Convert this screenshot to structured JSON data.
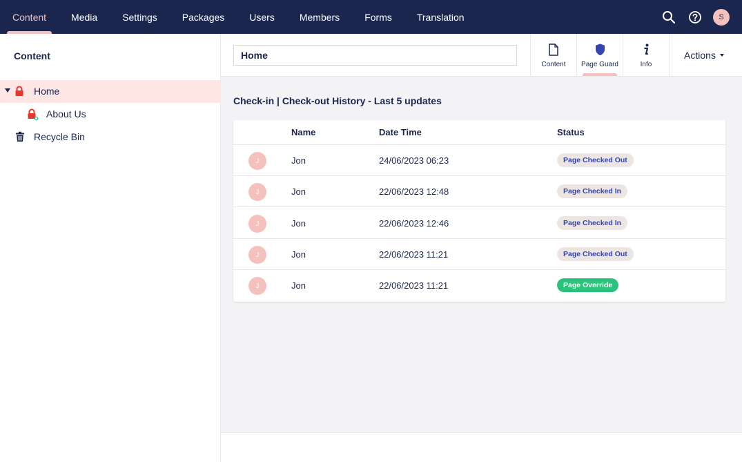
{
  "topnav": {
    "items": [
      {
        "label": "Content",
        "active": true
      },
      {
        "label": "Media"
      },
      {
        "label": "Settings"
      },
      {
        "label": "Packages"
      },
      {
        "label": "Users"
      },
      {
        "label": "Members"
      },
      {
        "label": "Forms"
      },
      {
        "label": "Translation"
      }
    ],
    "user_initial": "S",
    "icons": [
      "search-icon",
      "help-icon"
    ]
  },
  "sidebar": {
    "title": "Content",
    "tree": [
      {
        "label": "Home",
        "icon": "lock-icon",
        "selected": true,
        "expanded": true
      },
      {
        "label": "About Us",
        "icon": "lock-published-icon"
      },
      {
        "label": "Recycle Bin",
        "icon": "trash-icon"
      }
    ]
  },
  "header": {
    "node_name": "Home",
    "apps": [
      {
        "label": "Content",
        "icon": "document-icon"
      },
      {
        "label": "Page Guard",
        "icon": "shield-icon",
        "active": true
      },
      {
        "label": "Info",
        "icon": "info-icon"
      }
    ],
    "actions_label": "Actions"
  },
  "history": {
    "title": "Check-in | Check-out History - Last 5 updates",
    "columns": {
      "name": "Name",
      "datetime": "Date Time",
      "status": "Status"
    },
    "rows": [
      {
        "initial": "J",
        "name": "Jon",
        "datetime": "24/06/2023 06:23",
        "status": "Page Checked Out",
        "status_style": "grey"
      },
      {
        "initial": "J",
        "name": "Jon",
        "datetime": "22/06/2023 12:48",
        "status": "Page Checked In",
        "status_style": "grey"
      },
      {
        "initial": "J",
        "name": "Jon",
        "datetime": "22/06/2023 12:46",
        "status": "Page Checked In",
        "status_style": "grey"
      },
      {
        "initial": "J",
        "name": "Jon",
        "datetime": "22/06/2023 11:21",
        "status": "Page Checked Out",
        "status_style": "grey"
      },
      {
        "initial": "J",
        "name": "Jon",
        "datetime": "22/06/2023 11:21",
        "status": "Page Override",
        "status_style": "green"
      }
    ]
  },
  "colors": {
    "topbar": "#1b264f",
    "accent": "#f5c1bc",
    "selected_row": "#fde6e4",
    "lock_red": "#e6362d",
    "badge_grey": "#ece5e2",
    "badge_green": "#2bc37c",
    "shield_blue": "#3544b1"
  }
}
